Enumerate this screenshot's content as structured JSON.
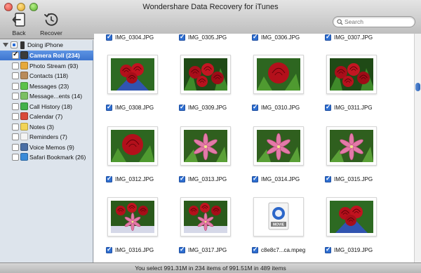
{
  "window": {
    "title": "Wondershare Data Recovery for iTunes"
  },
  "toolbar": {
    "back_label": "Back",
    "recover_label": "Recover"
  },
  "search": {
    "placeholder": "Search",
    "value": ""
  },
  "sidebar": {
    "device_label": "Doing iPhone",
    "items": [
      {
        "label": "Camera Roll (234)",
        "icon": "camera-icon",
        "color": "#3b3b3b",
        "checked": true,
        "selected": true
      },
      {
        "label": "Photo Stream (93)",
        "icon": "photo-stream-icon",
        "color": "#e6a93a",
        "checked": false
      },
      {
        "label": "Contacts (118)",
        "icon": "contacts-icon",
        "color": "#b98b5a",
        "checked": false
      },
      {
        "label": "Messages (23)",
        "icon": "messages-icon",
        "color": "#5cc24a",
        "checked": false
      },
      {
        "label": "Message...ents (14)",
        "icon": "message-attachments-icon",
        "color": "#7bbf62",
        "checked": false
      },
      {
        "label": "Call History (18)",
        "icon": "phone-icon",
        "color": "#43b14b",
        "checked": false
      },
      {
        "label": "Calendar (7)",
        "icon": "calendar-icon",
        "color": "#d94a3a",
        "checked": false
      },
      {
        "label": "Notes (3)",
        "icon": "notes-icon",
        "color": "#f2d456",
        "checked": false
      },
      {
        "label": "Reminders (7)",
        "icon": "reminders-icon",
        "color": "#f4f4f4",
        "checked": false
      },
      {
        "label": "Voice Memos (9)",
        "icon": "voice-memos-icon",
        "color": "#4a6fa5",
        "checked": false
      },
      {
        "label": "Safari Bookmark (26)",
        "icon": "safari-icon",
        "color": "#3b8bd8",
        "checked": false
      }
    ]
  },
  "grid": {
    "top_row": [
      "IMG_0304.JPG",
      "IMG_0305.JPG",
      "IMG_0306.JPG",
      "IMG_0307.JPG"
    ],
    "rows": [
      {
        "files": [
          "IMG_0308.JPG",
          "IMG_0309.JPG",
          "IMG_0310.JPG",
          "IMG_0311.JPG"
        ],
        "thumbs": [
          "rose-bouquet",
          "rose-cluster",
          "single-red-rose",
          "rose-cluster"
        ]
      },
      {
        "files": [
          "IMG_0312.JPG",
          "IMG_0313.JPG",
          "IMG_0314.JPG",
          "IMG_0315.JPG"
        ],
        "thumbs": [
          "single-red-rose",
          "pink-lily",
          "pink-lily",
          "pink-lily"
        ]
      },
      {
        "files": [
          "IMG_0316.JPG",
          "IMG_0317.JPG",
          "c8e8c7...ca.mpeg",
          "IMG_0319.JPG"
        ],
        "thumbs": [
          "rose-lily-bouquet",
          "rose-lily-bouquet",
          "movie-file",
          "rose-bouquet"
        ]
      }
    ],
    "movie_badge": "MOVIE"
  },
  "status": {
    "text": "You select 991.31M in 234 items of 991.51M in 489 items"
  },
  "colors": {
    "selection": "#3d75cf",
    "sidebar_bg": "#dde4ec",
    "rose": "#b3101b",
    "leaf": "#2f6b1e"
  }
}
